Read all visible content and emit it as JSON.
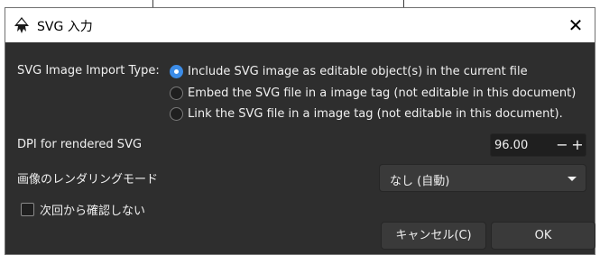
{
  "window": {
    "title": "SVG 入力",
    "close_glyph": "✕"
  },
  "import_type": {
    "label": "SVG Image Import Type:",
    "options": [
      {
        "label": "Include SVG image as editable object(s) in the current file",
        "selected": true
      },
      {
        "label": "Embed the SVG file in a image tag (not editable in this document)",
        "selected": false
      },
      {
        "label": "Link the SVG file in a image tag (not editable in this document).",
        "selected": false
      }
    ]
  },
  "dpi": {
    "label": "DPI for rendered SVG",
    "value": "96.00",
    "minus": "−",
    "plus": "+"
  },
  "render_mode": {
    "label": "画像のレンダリングモード",
    "value": "なし (自動)"
  },
  "dont_ask": {
    "label": "次回から確認しない",
    "checked": false
  },
  "buttons": {
    "cancel": "キャンセル(C)",
    "ok": "OK"
  },
  "colors": {
    "dialog_bg": "#2e2e2e",
    "accent": "#3c8ce7",
    "titlebar": "#ffffff"
  }
}
